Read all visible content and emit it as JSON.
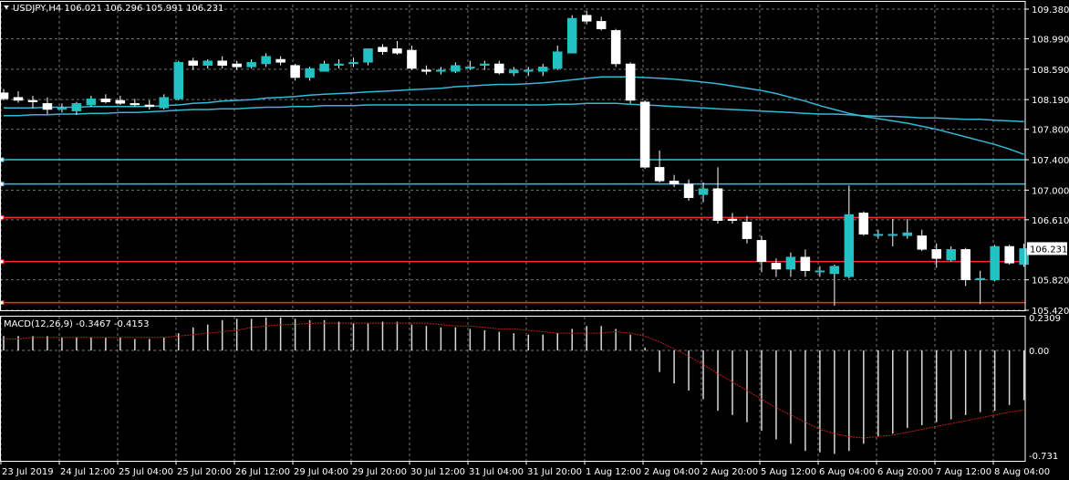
{
  "header": {
    "symbol_line": "USDJPY,H4  106.021 106.296 105.991 106.231",
    "indicator_line": "MACD(12,26,9) -0.3467 -0.4153"
  },
  "colors": {
    "background": "#000000",
    "grid": "#ffffff",
    "bull": "#22c1c3",
    "bear": "#ffffff",
    "ma": "#34b9d6",
    "level_cyan": "#2ec4e0",
    "level_red": "#ff2a2a",
    "signal": "#c0201a",
    "hist": "#d8d8d8",
    "price_box_bg": "#ffffff",
    "price_box_text": "#000000"
  },
  "chart_data": [
    {
      "type": "candlestick",
      "ylim": [
        105.42,
        109.38
      ],
      "yticks": [
        "109.380",
        "108.990",
        "108.590",
        "108.190",
        "107.800",
        "107.400",
        "107.000",
        "106.610",
        "106.231",
        "105.820",
        "105.420"
      ],
      "current_price": "106.231",
      "candles": [
        {
          "o": 108.28,
          "h": 108.33,
          "l": 108.18,
          "c": 108.2
        },
        {
          "o": 108.22,
          "h": 108.3,
          "l": 108.15,
          "c": 108.18
        },
        {
          "o": 108.18,
          "h": 108.24,
          "l": 108.08,
          "c": 108.16
        },
        {
          "o": 108.14,
          "h": 108.22,
          "l": 108.0,
          "c": 108.06
        },
        {
          "o": 108.06,
          "h": 108.14,
          "l": 108.02,
          "c": 108.08
        },
        {
          "o": 108.04,
          "h": 108.16,
          "l": 107.99,
          "c": 108.14
        },
        {
          "o": 108.12,
          "h": 108.24,
          "l": 108.1,
          "c": 108.2
        },
        {
          "o": 108.2,
          "h": 108.26,
          "l": 108.14,
          "c": 108.16
        },
        {
          "o": 108.18,
          "h": 108.24,
          "l": 108.12,
          "c": 108.14
        },
        {
          "o": 108.14,
          "h": 108.2,
          "l": 108.1,
          "c": 108.12
        },
        {
          "o": 108.12,
          "h": 108.18,
          "l": 108.06,
          "c": 108.1
        },
        {
          "o": 108.08,
          "h": 108.26,
          "l": 108.06,
          "c": 108.22
        },
        {
          "o": 108.2,
          "h": 108.7,
          "l": 108.18,
          "c": 108.68
        },
        {
          "o": 108.7,
          "h": 108.74,
          "l": 108.58,
          "c": 108.64
        },
        {
          "o": 108.64,
          "h": 108.72,
          "l": 108.6,
          "c": 108.7
        },
        {
          "o": 108.7,
          "h": 108.76,
          "l": 108.6,
          "c": 108.64
        },
        {
          "o": 108.66,
          "h": 108.7,
          "l": 108.58,
          "c": 108.62
        },
        {
          "o": 108.62,
          "h": 108.72,
          "l": 108.6,
          "c": 108.68
        },
        {
          "o": 108.66,
          "h": 108.8,
          "l": 108.62,
          "c": 108.76
        },
        {
          "o": 108.72,
          "h": 108.76,
          "l": 108.64,
          "c": 108.68
        },
        {
          "o": 108.64,
          "h": 108.66,
          "l": 108.44,
          "c": 108.48
        },
        {
          "o": 108.48,
          "h": 108.62,
          "l": 108.44,
          "c": 108.6
        },
        {
          "o": 108.56,
          "h": 108.7,
          "l": 108.56,
          "c": 108.66
        },
        {
          "o": 108.64,
          "h": 108.72,
          "l": 108.6,
          "c": 108.66
        },
        {
          "o": 108.66,
          "h": 108.74,
          "l": 108.62,
          "c": 108.68
        },
        {
          "o": 108.68,
          "h": 108.86,
          "l": 108.64,
          "c": 108.86
        },
        {
          "o": 108.88,
          "h": 108.92,
          "l": 108.78,
          "c": 108.82
        },
        {
          "o": 108.86,
          "h": 108.96,
          "l": 108.78,
          "c": 108.8
        },
        {
          "o": 108.84,
          "h": 108.9,
          "l": 108.58,
          "c": 108.6
        },
        {
          "o": 108.58,
          "h": 108.64,
          "l": 108.52,
          "c": 108.56
        },
        {
          "o": 108.56,
          "h": 108.62,
          "l": 108.52,
          "c": 108.58
        },
        {
          "o": 108.56,
          "h": 108.68,
          "l": 108.54,
          "c": 108.64
        },
        {
          "o": 108.62,
          "h": 108.7,
          "l": 108.58,
          "c": 108.62
        },
        {
          "o": 108.64,
          "h": 108.7,
          "l": 108.58,
          "c": 108.66
        },
        {
          "o": 108.66,
          "h": 108.7,
          "l": 108.52,
          "c": 108.54
        },
        {
          "o": 108.54,
          "h": 108.62,
          "l": 108.5,
          "c": 108.58
        },
        {
          "o": 108.56,
          "h": 108.62,
          "l": 108.5,
          "c": 108.58
        },
        {
          "o": 108.56,
          "h": 108.66,
          "l": 108.5,
          "c": 108.62
        },
        {
          "o": 108.6,
          "h": 108.9,
          "l": 108.58,
          "c": 108.82
        },
        {
          "o": 108.8,
          "h": 109.3,
          "l": 108.8,
          "c": 109.26
        },
        {
          "o": 109.3,
          "h": 109.36,
          "l": 109.18,
          "c": 109.22
        },
        {
          "o": 109.22,
          "h": 109.28,
          "l": 109.1,
          "c": 109.12
        },
        {
          "o": 109.1,
          "h": 109.12,
          "l": 108.62,
          "c": 108.66
        },
        {
          "o": 108.66,
          "h": 108.68,
          "l": 108.14,
          "c": 108.18
        },
        {
          "o": 108.16,
          "h": 108.18,
          "l": 107.28,
          "c": 107.3
        },
        {
          "o": 107.3,
          "h": 107.52,
          "l": 107.1,
          "c": 107.12
        },
        {
          "o": 107.12,
          "h": 107.2,
          "l": 107.04,
          "c": 107.08
        },
        {
          "o": 107.08,
          "h": 107.14,
          "l": 106.86,
          "c": 106.9
        },
        {
          "o": 106.94,
          "h": 107.1,
          "l": 106.84,
          "c": 107.02
        },
        {
          "o": 107.02,
          "h": 107.3,
          "l": 106.56,
          "c": 106.6
        },
        {
          "o": 106.62,
          "h": 106.7,
          "l": 106.56,
          "c": 106.6
        },
        {
          "o": 106.58,
          "h": 106.66,
          "l": 106.3,
          "c": 106.36
        },
        {
          "o": 106.34,
          "h": 106.4,
          "l": 105.92,
          "c": 106.06
        },
        {
          "o": 106.04,
          "h": 106.1,
          "l": 105.86,
          "c": 105.96
        },
        {
          "o": 105.96,
          "h": 106.18,
          "l": 105.86,
          "c": 106.12
        },
        {
          "o": 106.12,
          "h": 106.22,
          "l": 105.86,
          "c": 105.94
        },
        {
          "o": 105.94,
          "h": 106.0,
          "l": 105.86,
          "c": 105.94
        },
        {
          "o": 105.9,
          "h": 106.02,
          "l": 105.48,
          "c": 106.0
        },
        {
          "o": 105.86,
          "h": 107.06,
          "l": 105.84,
          "c": 106.68
        },
        {
          "o": 106.7,
          "h": 106.72,
          "l": 106.4,
          "c": 106.42
        },
        {
          "o": 106.42,
          "h": 106.48,
          "l": 106.36,
          "c": 106.42
        },
        {
          "o": 106.42,
          "h": 106.62,
          "l": 106.26,
          "c": 106.42
        },
        {
          "o": 106.4,
          "h": 106.62,
          "l": 106.36,
          "c": 106.44
        },
        {
          "o": 106.4,
          "h": 106.48,
          "l": 106.2,
          "c": 106.22
        },
        {
          "o": 106.22,
          "h": 106.3,
          "l": 105.98,
          "c": 106.1
        },
        {
          "o": 106.08,
          "h": 106.26,
          "l": 106.06,
          "c": 106.22
        },
        {
          "o": 106.22,
          "h": 106.24,
          "l": 105.74,
          "c": 105.82
        },
        {
          "o": 105.82,
          "h": 105.94,
          "l": 105.5,
          "c": 105.84
        },
        {
          "o": 105.82,
          "h": 106.28,
          "l": 105.8,
          "c": 106.26
        },
        {
          "o": 106.26,
          "h": 106.28,
          "l": 106.02,
          "c": 106.04
        },
        {
          "o": 106.021,
          "h": 106.296,
          "l": 105.991,
          "c": 106.231
        }
      ],
      "ma_fast": [
        108.08,
        108.08,
        108.08,
        108.09,
        108.09,
        108.09,
        108.1,
        108.1,
        108.1,
        108.1,
        108.1,
        108.11,
        108.12,
        108.14,
        108.15,
        108.17,
        108.18,
        108.19,
        108.21,
        108.22,
        108.23,
        108.25,
        108.26,
        108.27,
        108.28,
        108.29,
        108.3,
        108.31,
        108.32,
        108.33,
        108.34,
        108.36,
        108.37,
        108.38,
        108.39,
        108.39,
        108.4,
        108.41,
        108.43,
        108.45,
        108.47,
        108.49,
        108.49,
        108.49,
        108.48,
        108.47,
        108.46,
        108.44,
        108.42,
        108.4,
        108.37,
        108.34,
        108.31,
        108.27,
        108.22,
        108.17,
        108.11,
        108.06,
        108.01,
        107.97,
        107.94,
        107.91,
        107.88,
        107.84,
        107.8,
        107.75,
        107.7,
        107.65,
        107.6,
        107.54,
        107.47
      ],
      "ma_slow": [
        107.98,
        107.98,
        107.99,
        107.99,
        108.0,
        108.0,
        108.01,
        108.01,
        108.02,
        108.02,
        108.03,
        108.04,
        108.05,
        108.06,
        108.06,
        108.07,
        108.07,
        108.08,
        108.09,
        108.09,
        108.1,
        108.1,
        108.11,
        108.11,
        108.11,
        108.12,
        108.12,
        108.12,
        108.12,
        108.12,
        108.12,
        108.12,
        108.12,
        108.12,
        108.12,
        108.12,
        108.12,
        108.12,
        108.13,
        108.13,
        108.14,
        108.14,
        108.14,
        108.13,
        108.12,
        108.11,
        108.1,
        108.09,
        108.08,
        108.07,
        108.06,
        108.05,
        108.04,
        108.03,
        108.02,
        108.01,
        108.0,
        108.0,
        107.99,
        107.98,
        107.97,
        107.97,
        107.96,
        107.95,
        107.95,
        107.94,
        107.93,
        107.93,
        107.92,
        107.91,
        107.9
      ],
      "levels": [
        {
          "price": 107.4,
          "color": "cyan"
        },
        {
          "price": 107.08,
          "color": "cyan"
        },
        {
          "price": 106.64,
          "color": "red"
        },
        {
          "price": 106.06,
          "color": "red"
        },
        {
          "price": 105.52,
          "color": "red"
        }
      ]
    },
    {
      "type": "bar",
      "title": "MACD(12,26,9) -0.3467 -0.4153",
      "ylim": [
        -0.731,
        0.2309
      ],
      "yticks": [
        "0.2309",
        "0.00",
        "-0.731"
      ],
      "macd": [
        0.1,
        0.1,
        0.1,
        0.1,
        0.09,
        0.09,
        0.09,
        0.09,
        0.09,
        0.08,
        0.08,
        0.09,
        0.12,
        0.16,
        0.18,
        0.21,
        0.22,
        0.22,
        0.23,
        0.23,
        0.22,
        0.21,
        0.21,
        0.2,
        0.19,
        0.19,
        0.2,
        0.2,
        0.18,
        0.17,
        0.16,
        0.16,
        0.15,
        0.14,
        0.13,
        0.12,
        0.11,
        0.11,
        0.12,
        0.15,
        0.17,
        0.17,
        0.15,
        0.11,
        0.02,
        -0.15,
        -0.23,
        -0.28,
        -0.34,
        -0.42,
        -0.45,
        -0.5,
        -0.56,
        -0.62,
        -0.65,
        -0.7,
        -0.71,
        -0.72,
        -0.7,
        -0.65,
        -0.6,
        -0.58,
        -0.54,
        -0.52,
        -0.5,
        -0.48,
        -0.45,
        -0.43,
        -0.42,
        -0.38,
        -0.3467
      ],
      "signal": [
        0.08,
        0.08,
        0.09,
        0.09,
        0.09,
        0.09,
        0.09,
        0.09,
        0.09,
        0.09,
        0.09,
        0.09,
        0.1,
        0.11,
        0.12,
        0.13,
        0.14,
        0.16,
        0.17,
        0.18,
        0.18,
        0.19,
        0.19,
        0.19,
        0.19,
        0.19,
        0.19,
        0.19,
        0.19,
        0.19,
        0.18,
        0.17,
        0.17,
        0.16,
        0.15,
        0.15,
        0.14,
        0.13,
        0.12,
        0.12,
        0.12,
        0.12,
        0.13,
        0.12,
        0.1,
        0.06,
        0.01,
        -0.04,
        -0.1,
        -0.16,
        -0.22,
        -0.28,
        -0.34,
        -0.4,
        -0.45,
        -0.5,
        -0.55,
        -0.58,
        -0.6,
        -0.61,
        -0.6,
        -0.59,
        -0.57,
        -0.55,
        -0.53,
        -0.51,
        -0.49,
        -0.47,
        -0.45,
        -0.43,
        -0.4153
      ]
    }
  ],
  "x_axis": {
    "labels": [
      "23 Jul 2019",
      "24 Jul 12:00",
      "25 Jul 04:00",
      "25 Jul 20:00",
      "26 Jul 12:00",
      "29 Jul 04:00",
      "29 Jul 20:00",
      "30 Jul 12:00",
      "31 Jul 04:00",
      "31 Jul 20:00",
      "1 Aug 12:00",
      "2 Aug 04:00",
      "2 Aug 20:00",
      "5 Aug 12:00",
      "6 Aug 04:00",
      "6 Aug 20:00",
      "7 Aug 12:00",
      "8 Aug 04:00"
    ]
  }
}
